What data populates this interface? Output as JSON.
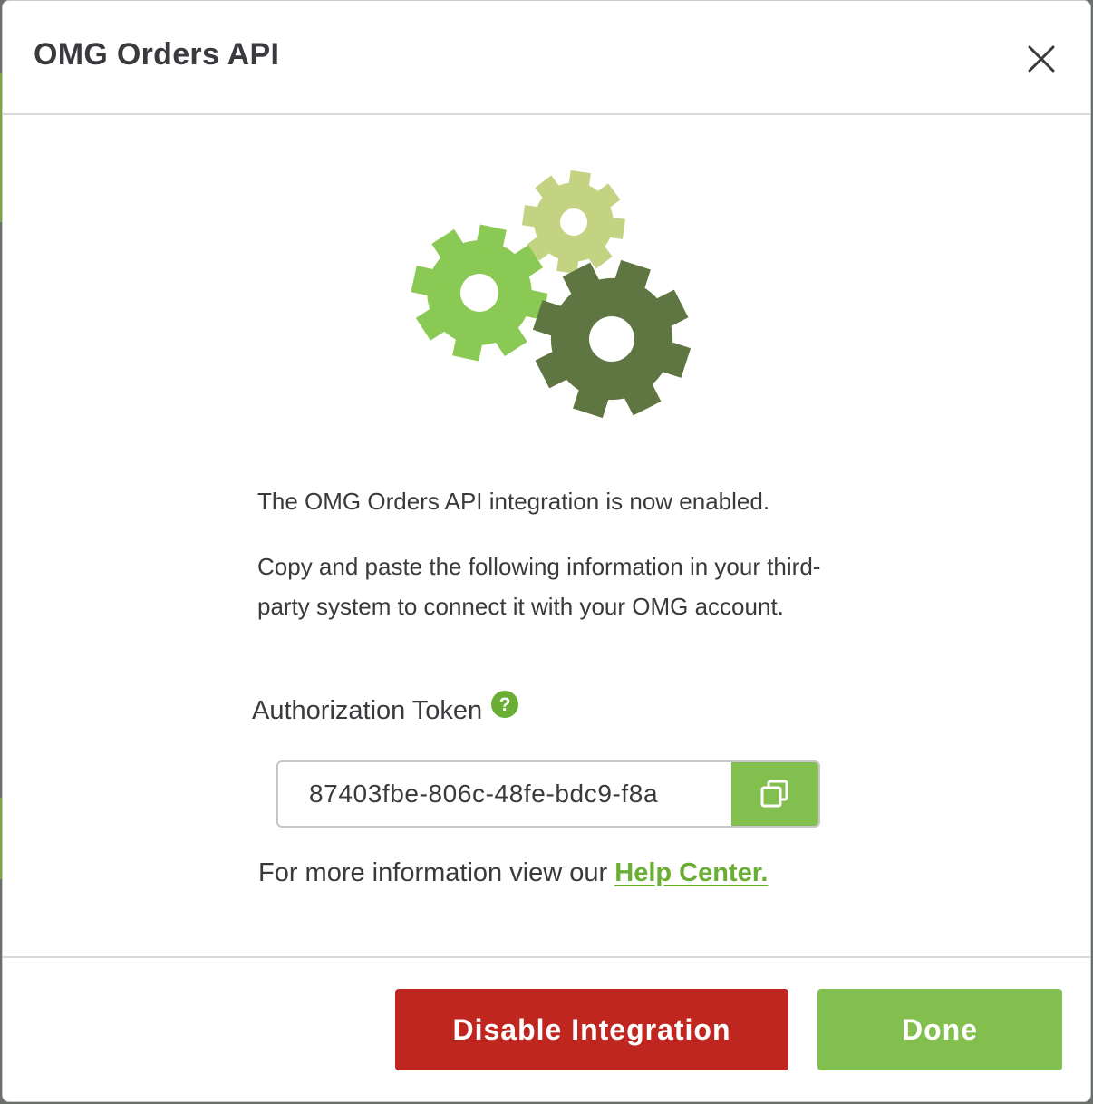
{
  "dialog": {
    "title": "OMG Orders API",
    "close_icon": "close-icon"
  },
  "illustration": {
    "icon": "gears-icon",
    "colors": {
      "gear_light": "#c3d382",
      "gear_mid": "#8ac953",
      "gear_dark": "#5f7542"
    }
  },
  "body": {
    "enabled_message": "The OMG Orders API integration is now enabled.",
    "copy_message": "Copy and paste the following information in your third-party system to connect it with your OMG account.",
    "token_label": "Authorization Token",
    "help_icon": "question-circle-icon",
    "token_value": "87403fbe-806c-48fe-bdc9-f8a",
    "copy_icon": "copy-icon",
    "help_line_prefix": "For more information view our ",
    "help_link_label": "Help Center."
  },
  "footer": {
    "disable_label": "Disable Integration",
    "done_label": "Done"
  },
  "colors": {
    "accent_green": "#83bf4f",
    "danger_red": "#bf2620",
    "text": "#393a3d",
    "link_green": "#6aae34"
  }
}
